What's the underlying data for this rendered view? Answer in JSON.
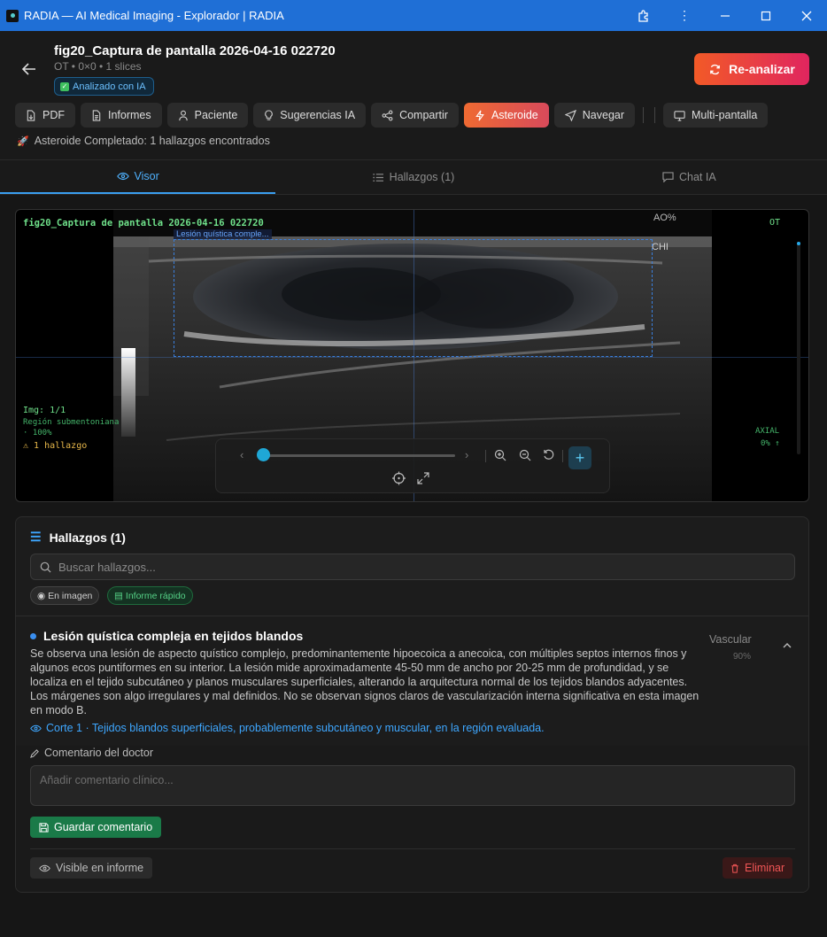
{
  "window": {
    "title": "RADIA — AI Medical Imaging - Explorador | RADIA",
    "controls": [
      "extensions-icon",
      "menu-icon",
      "minimize",
      "maximize",
      "close"
    ]
  },
  "header": {
    "study_title": "fig20_Captura de pantalla 2026-04-16 022720",
    "study_sub": "OT • 0×0 • 1 slices",
    "ai_badge": "Analizado con IA",
    "reanalyze_label": "Re-analizar"
  },
  "toolbar": {
    "items": [
      {
        "label": "PDF",
        "icon": "file-icon"
      },
      {
        "label": "Informes",
        "icon": "document-icon"
      },
      {
        "label": "Paciente",
        "icon": "user-icon"
      },
      {
        "label": "Sugerencias IA",
        "icon": "lightbulb-icon"
      },
      {
        "label": "Compartir",
        "icon": "share-icon"
      },
      {
        "label": "Asteroide",
        "icon": "bolt-icon",
        "active": true
      },
      {
        "label": "Navegar",
        "icon": "send-icon"
      },
      {
        "label": "Multi-pantalla",
        "icon": "monitor-icon"
      }
    ]
  },
  "status": "Asteroide Completado: 1 hallazgos encontrados",
  "tabs": [
    {
      "label": "Visor",
      "active": true
    },
    {
      "label": "Hallazgos (1)",
      "active": false
    },
    {
      "label": "Chat IA",
      "active": false
    }
  ],
  "viewer": {
    "overlay_title": "fig20_Captura de pantalla 2026-04-16 022720",
    "modality": "OT",
    "detection_label": "Lesión quística comple...",
    "img_index": "Img: 1/1",
    "region": "Región submentoniana",
    "zoom": "· 100%",
    "findings_count": "⚠ 1 hallazgo",
    "plane": "AXIAL",
    "plane_value": "0% ↑",
    "slice_position": 0
  },
  "findings_panel": {
    "title": "Hallazgos (1)",
    "search_placeholder": "Buscar hallazgos...",
    "chip_image": "En imagen",
    "chip_report": "Informe rápido",
    "finding": {
      "title": "Lesión quística compleja en tejidos blandos",
      "description": "Se observa una lesión de aspecto quístico complejo, predominantemente hipoecoica a anecoica, con múltiples septos internos finos y algunos ecos puntiformes en su interior. La lesión mide aproximadamente 45-50 mm de ancho por 20-25 mm de profundidad, y se localiza en el tejido subcutáneo y planos musculares superficiales, alterando la arquitectura normal de los tejidos blandos adyacentes. Los márgenes son algo irregulares y mal definidos. No se observan signos claros de vascularización interna significativa en esta imagen en modo B.",
      "location": "Corte 1 · Tejidos blandos superficiales, probablemente subcutáneo y muscular, en la región evaluada.",
      "category": "Vascular",
      "confidence": "90%"
    },
    "comment_label": "Comentario del doctor",
    "comment_placeholder": "Añadir comentario clínico...",
    "save_label": "Guardar comentario",
    "visible_label": "Visible en informe",
    "delete_label": "Eliminar"
  },
  "colors": {
    "accent": "#3a9ff0",
    "reanalyze_start": "#f25a27",
    "reanalyze_end": "#e0255f",
    "save": "#1a7a48",
    "delete": "#ef5555"
  }
}
